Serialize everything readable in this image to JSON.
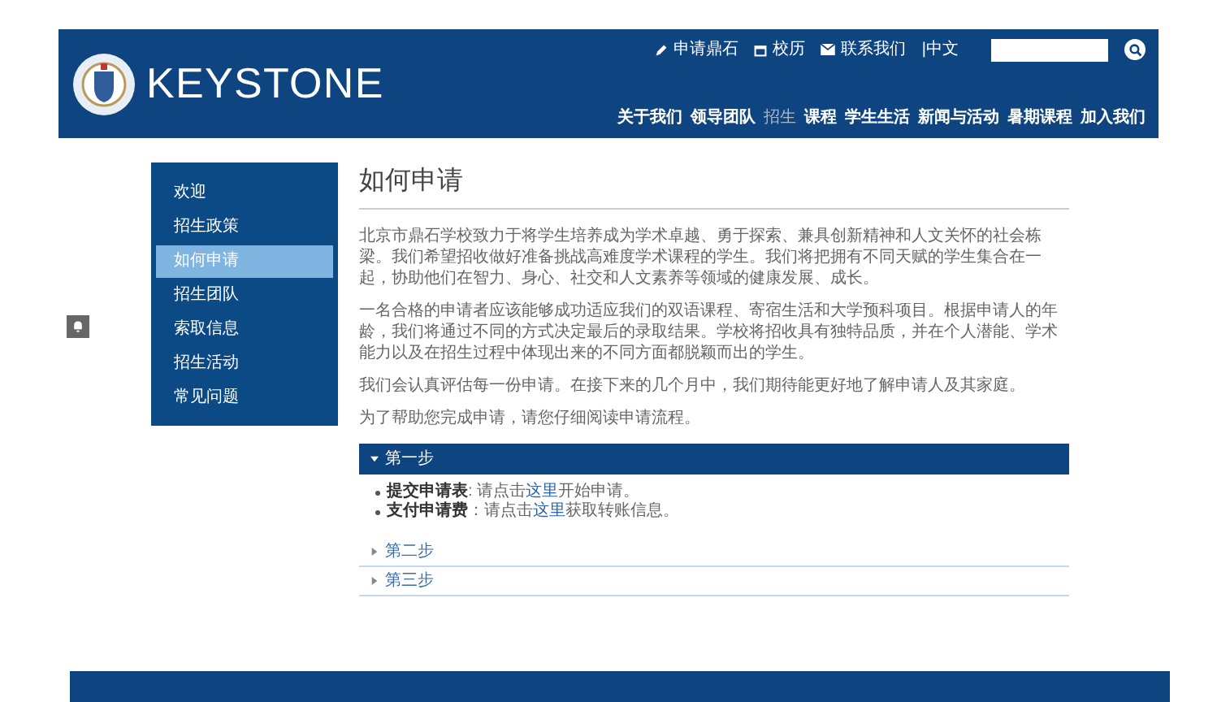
{
  "header": {
    "brand": "KEYSTONE",
    "utility_links": [
      {
        "kind": "apply",
        "label": "申请鼎石"
      },
      {
        "kind": "calendar",
        "label": "校历"
      },
      {
        "kind": "contact",
        "label": "联系我们"
      }
    ],
    "language": "|中文",
    "nav": [
      {
        "label": "关于我们",
        "selected": false
      },
      {
        "label": "领导团队",
        "selected": false
      },
      {
        "label": "招生",
        "selected": true
      },
      {
        "label": "课程",
        "selected": false
      },
      {
        "label": "学生生活",
        "selected": false
      },
      {
        "label": "新闻与活动",
        "selected": false
      },
      {
        "label": "暑期课程",
        "selected": false
      },
      {
        "label": "加入我们",
        "selected": false
      }
    ]
  },
  "sidebar": {
    "items": [
      {
        "label": "欢迎",
        "selected": false
      },
      {
        "label": "招生政策",
        "selected": false
      },
      {
        "label": "如何申请",
        "selected": true
      },
      {
        "label": "招生团队",
        "selected": false
      },
      {
        "label": "索取信息",
        "selected": false
      },
      {
        "label": "招生活动",
        "selected": false
      },
      {
        "label": "常见问题",
        "selected": false
      }
    ]
  },
  "content": {
    "title": "如何申请",
    "paragraphs": [
      "北京市鼎石学校致力于将学生培养成为学术卓越、勇于探索、兼具创新精神和人文关怀的社会栋梁。我们希望招收做好准备挑战高难度学术课程的学生。我们将把拥有不同天赋的学生集合在一起，协助他们在智力、身心、社交和人文素养等领域的健康发展、成长。",
      "一名合格的申请者应该能够成功适应我们的双语课程、寄宿生活和大学预科项目。根据申请人的年龄，我们将通过不同的方式决定最后的录取结果。学校将招收具有独特品质，并在个人潜能、学术能力以及在招生过程中体现出来的不同方面都脱颖而出的学生。",
      "我们会认真评估每一份申请。在接下来的几个月中，我们期待能更好地了解申请人及其家庭。",
      "为了帮助您完成申请，请您仔细阅读申请流程。"
    ],
    "steps": [
      {
        "label": "第一步",
        "expanded": true,
        "bullets": [
          {
            "term": "提交申请表",
            "before": ": 请点击",
            "link": "这里",
            "after": "开始申请。"
          },
          {
            "term": "支付申请费",
            "before": "：请点击",
            "link": "这里",
            "after": "获取转账信息。"
          }
        ]
      },
      {
        "label": "第二步",
        "expanded": false
      },
      {
        "label": "第三步",
        "expanded": false
      }
    ]
  }
}
